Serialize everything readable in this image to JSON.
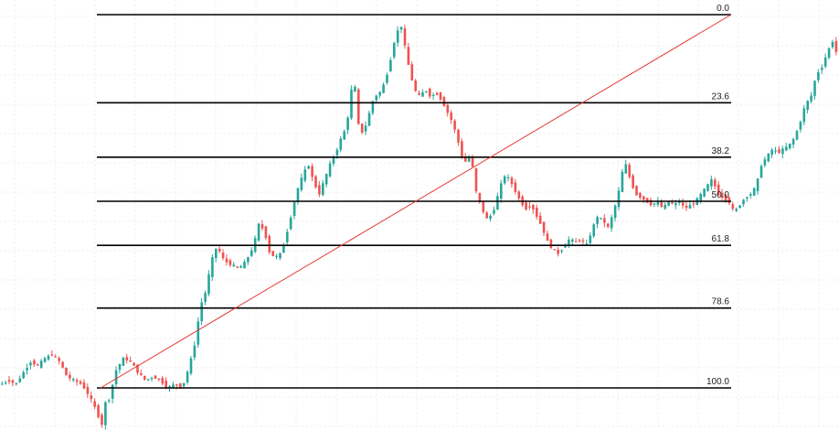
{
  "chart_data": {
    "type": "candlestick",
    "title": "",
    "xlabel": "",
    "ylabel": "",
    "grid": true,
    "colors": {
      "up": "#26a69a",
      "down": "#ef5350",
      "fib_line": "#000000",
      "trend_line": "#e53935",
      "grid": "#ececec"
    },
    "fibonacci_levels": [
      {
        "label": "0.0",
        "ratio": 0.0
      },
      {
        "label": "23.6",
        "ratio": 0.236
      },
      {
        "label": "38.2",
        "ratio": 0.382
      },
      {
        "label": "50.0",
        "ratio": 0.5
      },
      {
        "label": "61.8",
        "ratio": 0.618
      },
      {
        "label": "78.6",
        "ratio": 0.786
      },
      {
        "label": "100.0",
        "ratio": 1.0
      }
    ],
    "price_path": [
      [
        0,
        0.99
      ],
      [
        8,
        0.98
      ],
      [
        16,
        0.99
      ],
      [
        24,
        0.96
      ],
      [
        32,
        0.93
      ],
      [
        40,
        0.94
      ],
      [
        48,
        0.92
      ],
      [
        56,
        0.91
      ],
      [
        64,
        0.93
      ],
      [
        72,
        0.97
      ],
      [
        80,
        0.98
      ],
      [
        88,
        0.99
      ],
      [
        96,
        1.02
      ],
      [
        104,
        1.06
      ],
      [
        110,
        1.1
      ],
      [
        114,
        1.04
      ],
      [
        118,
        1.03
      ],
      [
        126,
        0.95
      ],
      [
        134,
        0.92
      ],
      [
        142,
        0.93
      ],
      [
        150,
        0.96
      ],
      [
        158,
        0.98
      ],
      [
        166,
        0.97
      ],
      [
        174,
        0.98
      ],
      [
        182,
        1.0
      ],
      [
        190,
        0.99
      ],
      [
        198,
        1.0
      ],
      [
        206,
        0.94
      ],
      [
        212,
        0.88
      ],
      [
        218,
        0.78
      ],
      [
        224,
        0.74
      ],
      [
        230,
        0.66
      ],
      [
        236,
        0.62
      ],
      [
        244,
        0.66
      ],
      [
        252,
        0.67
      ],
      [
        260,
        0.68
      ],
      [
        268,
        0.66
      ],
      [
        276,
        0.62
      ],
      [
        282,
        0.56
      ],
      [
        288,
        0.58
      ],
      [
        294,
        0.64
      ],
      [
        300,
        0.65
      ],
      [
        306,
        0.64
      ],
      [
        312,
        0.59
      ],
      [
        318,
        0.53
      ],
      [
        324,
        0.47
      ],
      [
        330,
        0.43
      ],
      [
        336,
        0.4
      ],
      [
        342,
        0.45
      ],
      [
        348,
        0.48
      ],
      [
        354,
        0.44
      ],
      [
        360,
        0.4
      ],
      [
        366,
        0.37
      ],
      [
        372,
        0.33
      ],
      [
        378,
        0.3
      ],
      [
        382,
        0.22
      ],
      [
        386,
        0.16
      ],
      [
        390,
        0.29
      ],
      [
        396,
        0.32
      ],
      [
        402,
        0.27
      ],
      [
        408,
        0.22
      ],
      [
        414,
        0.21
      ],
      [
        420,
        0.18
      ],
      [
        426,
        0.12
      ],
      [
        432,
        0.05
      ],
      [
        438,
        0.03
      ],
      [
        442,
        0.09
      ],
      [
        446,
        0.14
      ],
      [
        452,
        0.2
      ],
      [
        458,
        0.22
      ],
      [
        464,
        0.2
      ],
      [
        470,
        0.22
      ],
      [
        476,
        0.21
      ],
      [
        482,
        0.23
      ],
      [
        488,
        0.26
      ],
      [
        494,
        0.29
      ],
      [
        500,
        0.34
      ],
      [
        506,
        0.4
      ],
      [
        512,
        0.38
      ],
      [
        516,
        0.41
      ],
      [
        520,
        0.48
      ],
      [
        526,
        0.52
      ],
      [
        532,
        0.55
      ],
      [
        538,
        0.53
      ],
      [
        544,
        0.48
      ],
      [
        550,
        0.43
      ],
      [
        556,
        0.44
      ],
      [
        562,
        0.47
      ],
      [
        568,
        0.5
      ],
      [
        574,
        0.52
      ],
      [
        580,
        0.51
      ],
      [
        586,
        0.54
      ],
      [
        592,
        0.57
      ],
      [
        598,
        0.61
      ],
      [
        604,
        0.63
      ],
      [
        610,
        0.64
      ],
      [
        616,
        0.62
      ],
      [
        622,
        0.6
      ],
      [
        628,
        0.61
      ],
      [
        634,
        0.6
      ],
      [
        640,
        0.62
      ],
      [
        646,
        0.58
      ],
      [
        652,
        0.54
      ],
      [
        658,
        0.55
      ],
      [
        664,
        0.57
      ],
      [
        670,
        0.53
      ],
      [
        676,
        0.47
      ],
      [
        682,
        0.39
      ],
      [
        688,
        0.44
      ],
      [
        694,
        0.48
      ],
      [
        700,
        0.49
      ],
      [
        706,
        0.5
      ],
      [
        712,
        0.51
      ],
      [
        718,
        0.5
      ],
      [
        724,
        0.52
      ],
      [
        730,
        0.5
      ],
      [
        736,
        0.51
      ],
      [
        742,
        0.5
      ],
      [
        748,
        0.52
      ],
      [
        754,
        0.51
      ],
      [
        760,
        0.5
      ],
      [
        766,
        0.48
      ],
      [
        772,
        0.46
      ],
      [
        778,
        0.44
      ],
      [
        784,
        0.48
      ],
      [
        790,
        0.49
      ],
      [
        796,
        0.5
      ],
      [
        802,
        0.53
      ],
      [
        808,
        0.51
      ],
      [
        814,
        0.49
      ],
      [
        820,
        0.48
      ],
      [
        826,
        0.46
      ],
      [
        832,
        0.4
      ],
      [
        838,
        0.38
      ],
      [
        844,
        0.36
      ],
      [
        850,
        0.37
      ],
      [
        856,
        0.36
      ],
      [
        862,
        0.35
      ],
      [
        868,
        0.33
      ],
      [
        874,
        0.29
      ],
      [
        880,
        0.24
      ],
      [
        886,
        0.22
      ],
      [
        892,
        0.16
      ],
      [
        898,
        0.14
      ],
      [
        904,
        0.1
      ],
      [
        910,
        0.07
      ],
      [
        916,
        0.12
      ]
    ]
  }
}
